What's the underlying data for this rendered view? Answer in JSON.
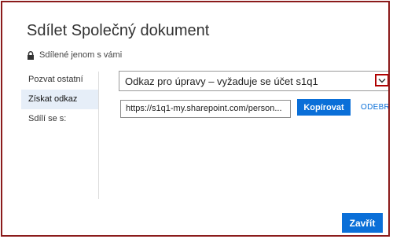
{
  "dialog": {
    "title": "Sdílet Společný dokument",
    "shared_status": "Sdílené jenom s vámi"
  },
  "nav": {
    "items": [
      {
        "label": "Pozvat ostatní"
      },
      {
        "label": "Získat odkaz"
      },
      {
        "label": "Sdílí se s:"
      }
    ]
  },
  "link": {
    "permission_select": "Odkaz pro úpravy – vyžaduje se účet s1q1",
    "url": "https://s1q1-my.sharepoint.com/person...",
    "copy_label": "Kopírovat",
    "remove_label": "ODEBRAT"
  },
  "footer": {
    "close_label": "Zavřít"
  },
  "colors": {
    "accent": "#0a6fd8",
    "highlight_border": "#b00000",
    "nav_active_bg": "#e6eef8"
  }
}
